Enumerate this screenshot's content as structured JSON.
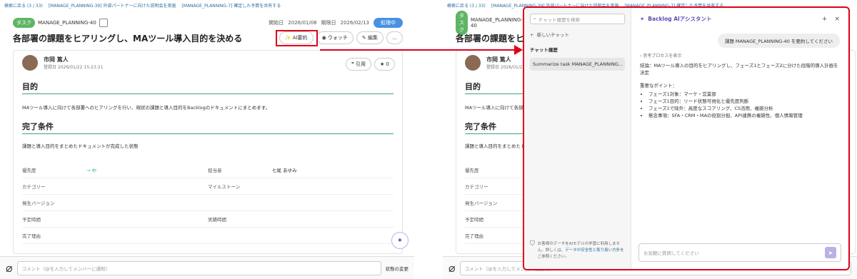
{
  "breadcrumb": {
    "back": "検索に戻る (3 / 33)",
    "prev": "[MANAGE_PLANNING-39] 外部パートナーに向けた説明会を実施",
    "next": "[MANAGE_PLANNING-7] 確定した予算を共有する"
  },
  "issue": {
    "type_tag": "タスク",
    "key": "MANAGE_PLANNING-40",
    "start_label": "開始日",
    "start_date": "2026/01/08",
    "due_label": "期限日",
    "due_date": "2026/02/13",
    "status": "処理中",
    "title": "各部署の課題をヒアリングし、MAツール導入目的を決める",
    "ai_button": "AI要約",
    "watch_button": "ウォッチ",
    "edit_button": "編集",
    "author_name": "市岡 篤人",
    "author_date": "登録日 2026/01/22 15:23:21",
    "quote_button": "引用",
    "star_count": "0",
    "section1_title": "目的",
    "section1_text": "MAツール導入に向けて各部署へのヒアリングを行い、現状の課題と導入目的をBacklogのドキュメントにまとめます。",
    "section2_title": "完了条件",
    "section2_text": "課題と導入目的をまとめたドキュメントが完成した状態",
    "fields": {
      "priority_label": "優先度",
      "priority_value": "→ 中",
      "assignee_label": "担当者",
      "assignee_value": "七尾 あゆみ",
      "category_label": "カテゴリー",
      "milestone_label": "マイルストーン",
      "version_label": "発生バージョン",
      "est_label": "予定時間",
      "actual_label": "実績時間",
      "reason_label": "完了理由"
    }
  },
  "comment": {
    "placeholder": "コメント（@を入力してメンバーに通知）",
    "status_change": "状態の変更"
  },
  "assistant": {
    "search_placeholder": "チャット履歴を検索",
    "new_chat": "新しいチャット",
    "history_title": "チャット履歴",
    "history_item": "Summarize task MANAGE_PLANNING...",
    "privacy_text": "お客様のデータをAIモデルの学習に利用しません。詳しくは、",
    "privacy_link": "データの安全性と取り扱い方針",
    "privacy_tail": "をご参照ください。",
    "title": "Backlog AIアシスタント",
    "user_message": "課題 MANAGE_PLANNING-40 を要約してください",
    "process_label": "思考プロセスを表示",
    "conclusion": "結論：MAツール導入の目的をヒアリングし、フェーズ1とフェーズ2に分けた段階的導入計画を決定",
    "points_title": "重要なポイント：",
    "points": [
      "フェーズ1対象：マーケ・営業部",
      "フェーズ1目的：リード状態可視化と優先度判断",
      "フェーズ1で除外：高度なスコアリング、CS活用、複雑分析",
      "懸念事項：SFA・CRM・MAの役割分担、API連携の複雑性、個人情報管理"
    ],
    "input_placeholder": "お気軽に質問してください"
  }
}
